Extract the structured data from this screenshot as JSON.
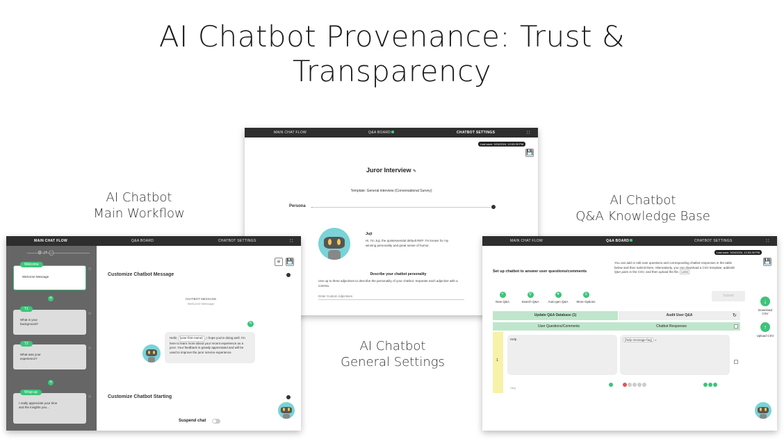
{
  "slide": {
    "title_line1": "AI Chatbot Provenance: Trust &",
    "title_line2": "Transparency",
    "caption_left_1": "AI Chatbot",
    "caption_left_2": "Main Workflow",
    "caption_right_1": "AI Chatbot",
    "caption_right_2": "Q&A Knowledge Base",
    "caption_center_1": "AI Chatbot",
    "caption_center_2": "General Settings"
  },
  "nav": {
    "main": "MAIN CHAT FLOW",
    "qa": "Q&A BOARD",
    "settings": "CHATBOT SETTINGS"
  },
  "settings_shot": {
    "last_save": "Last save: 3/24/2024, 12:53:39 PM",
    "heading": "Juror Interview",
    "template": "Template: General interview (Conversational Survey)",
    "persona_label": "Persona",
    "bot_name": "Juji",
    "bot_intro": "Hi, I'm Juji, the quintessential default REP. I'm known for my winning personality and great sense of humor.",
    "describe_title": "Describe your chatbot personality",
    "describe_text": "Use up to three adjectives to describe the personality of your chatbot. Separate each adjective with a comma.",
    "adjectives_placeholder": "Enter Custom Adjectives"
  },
  "flow_shot": {
    "nodes": [
      {
        "tag": "Welcome",
        "text": "Welcome Message"
      },
      {
        "tag": "T1",
        "text": "What is your background?"
      },
      {
        "tag": "T2",
        "text": "What was your experience?"
      },
      {
        "tag": "Wrap-up",
        "text": "I really appreciate your time and the insights you..."
      }
    ],
    "section1": "Customize Chatbot Message",
    "chatbot_message_label": "CHATBOT MESSAGE",
    "chatbot_message_sub": "Welcome Message",
    "message_prefix": "Hello",
    "message_chip": "{user-first-name}",
    "message_rest": ", I hope you're doing well. I'm here to learn more about your recent experience as a juror. Your feedback is greatly appreciated and will be used to improve the juror service experience.",
    "section2": "Customize Chatbot Starting",
    "suspend_label": "Suspend chat"
  },
  "qa_shot": {
    "last_save": "Last save: 3/24/2024, 12:53:39 PM",
    "setup_heading": "Set up chatbot to answer user questions/comments",
    "setup_text": "You can add or edit user questions and corresponding chatbot responses in the table below and then submit them. Alternatively, you can download a CSV template, add/edit Q&A pairs in the CSV, and then upload the file.",
    "less_link": "Less",
    "tools": [
      "New Q&A",
      "Search Q&A",
      "Auto-gen Q&A",
      "More Options"
    ],
    "submit": "Submit",
    "update_tab": "Update Q&A Database (1)",
    "audit_tab": "Audit User Q&A",
    "col_questions": "User Questions/Comments",
    "col_responses": "Chatbot Responses",
    "row_number": "1",
    "question": "Help",
    "response_chip": "{help-message-faq}",
    "footer_hint": "Help",
    "download": "Download CSV",
    "upload": "Upload CSV"
  },
  "colors": {
    "accent_green": "#3cc47a",
    "nav_dark": "#2e2e2e",
    "sidebar_gray": "#666666",
    "bot_teal": "#7ad3d6"
  }
}
